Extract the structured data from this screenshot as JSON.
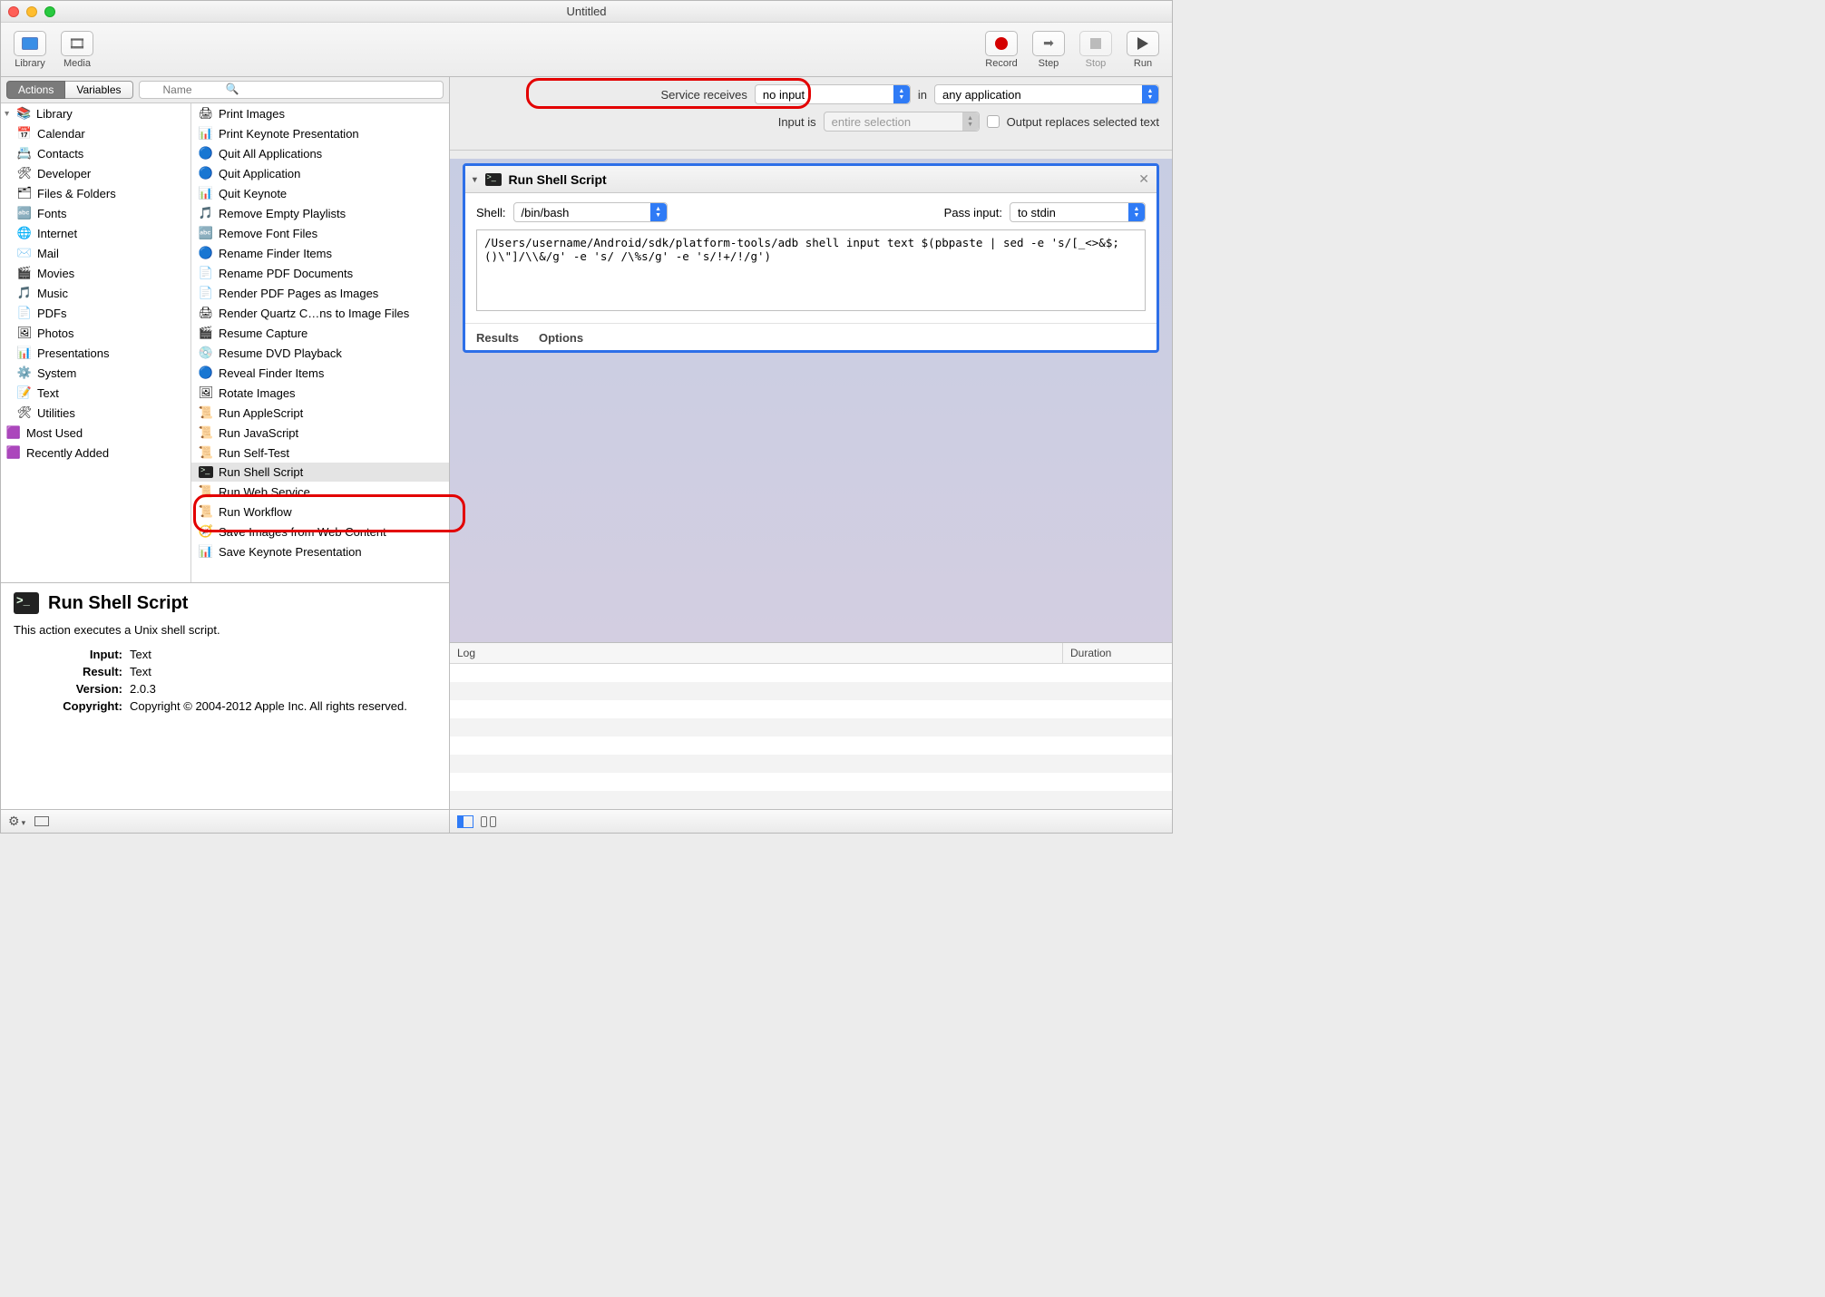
{
  "window": {
    "title": "Untitled"
  },
  "toolbar": {
    "library": "Library",
    "media": "Media",
    "record": "Record",
    "step": "Step",
    "stop": "Stop",
    "run": "Run"
  },
  "filter": {
    "actions": "Actions",
    "variables": "Variables",
    "search_placeholder": "Name"
  },
  "library_tree": {
    "top": "Library",
    "items": [
      {
        "icon": "📅",
        "label": "Calendar"
      },
      {
        "icon": "📇",
        "label": "Contacts"
      },
      {
        "icon": "🛠",
        "label": "Developer"
      },
      {
        "icon": "🗂",
        "label": "Files & Folders"
      },
      {
        "icon": "🔤",
        "label": "Fonts"
      },
      {
        "icon": "🌐",
        "label": "Internet"
      },
      {
        "icon": "✉️",
        "label": "Mail"
      },
      {
        "icon": "🎬",
        "label": "Movies"
      },
      {
        "icon": "🎵",
        "label": "Music"
      },
      {
        "icon": "📄",
        "label": "PDFs"
      },
      {
        "icon": "🖼",
        "label": "Photos"
      },
      {
        "icon": "📊",
        "label": "Presentations"
      },
      {
        "icon": "⚙️",
        "label": "System"
      },
      {
        "icon": "📝",
        "label": "Text"
      },
      {
        "icon": "🛠",
        "label": "Utilities"
      }
    ],
    "extra": [
      {
        "icon": "🟪",
        "label": "Most Used"
      },
      {
        "icon": "🟪",
        "label": "Recently Added"
      }
    ]
  },
  "actions": [
    {
      "icon": "🖨",
      "label": "Print Images"
    },
    {
      "icon": "📊",
      "label": "Print Keynote Presentation"
    },
    {
      "icon": "🔵",
      "label": "Quit All Applications"
    },
    {
      "icon": "🔵",
      "label": "Quit Application"
    },
    {
      "icon": "📊",
      "label": "Quit Keynote"
    },
    {
      "icon": "🎵",
      "label": "Remove Empty Playlists"
    },
    {
      "icon": "🔤",
      "label": "Remove Font Files"
    },
    {
      "icon": "🔵",
      "label": "Rename Finder Items"
    },
    {
      "icon": "📄",
      "label": "Rename PDF Documents"
    },
    {
      "icon": "📄",
      "label": "Render PDF Pages as Images"
    },
    {
      "icon": "🖨",
      "label": "Render Quartz C…ns to Image Files"
    },
    {
      "icon": "🎬",
      "label": "Resume Capture"
    },
    {
      "icon": "💿",
      "label": "Resume DVD Playback"
    },
    {
      "icon": "🔵",
      "label": "Reveal Finder Items"
    },
    {
      "icon": "🖼",
      "label": "Rotate Images"
    },
    {
      "icon": "📜",
      "label": "Run AppleScript"
    },
    {
      "icon": "📜",
      "label": "Run JavaScript"
    },
    {
      "icon": "📜",
      "label": "Run Self-Test"
    },
    {
      "icon": "⬛",
      "label": "Run Shell Script",
      "selected": true
    },
    {
      "icon": "📜",
      "label": "Run Web Service"
    },
    {
      "icon": "📜",
      "label": "Run Workflow"
    },
    {
      "icon": "🧭",
      "label": "Save Images from Web Content"
    },
    {
      "icon": "📊",
      "label": "Save Keynote Presentation"
    }
  ],
  "description": {
    "title": "Run Shell Script",
    "body": "This action executes a Unix shell script.",
    "rows": [
      {
        "k": "Input:",
        "v": "Text"
      },
      {
        "k": "Result:",
        "v": "Text"
      },
      {
        "k": "Version:",
        "v": "2.0.3"
      },
      {
        "k": "Copyright:",
        "v": "Copyright © 2004-2012 Apple Inc.  All rights reserved."
      }
    ]
  },
  "service": {
    "receives_label": "Service receives",
    "receives_value": "no input",
    "in_label": "in",
    "in_value": "any application",
    "input_is_label": "Input is",
    "input_is_value": "entire selection",
    "output_label": "Output replaces selected text"
  },
  "card": {
    "title": "Run Shell Script",
    "shell_label": "Shell:",
    "shell_value": "/bin/bash",
    "pass_label": "Pass input:",
    "pass_value": "to stdin",
    "script": "/Users/username/Android/sdk/platform-tools/adb shell input text $(pbpaste | sed -e 's/[_<>&$;()\\\"]/\\\\&/g' -e 's/ /\\%s/g' -e 's/!+/!/g')",
    "results_tab": "Results",
    "options_tab": "Options"
  },
  "log": {
    "col_log": "Log",
    "col_duration": "Duration"
  }
}
